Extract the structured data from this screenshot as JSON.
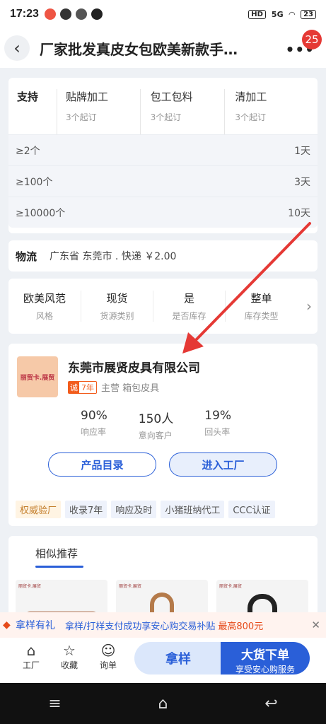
{
  "status_bar": {
    "time": "17:23",
    "signal": "5G",
    "battery": "23",
    "sim_label": "HD"
  },
  "header": {
    "title": "厂家批发真皮女包欧美新款手…",
    "badge_count": "25"
  },
  "support": {
    "label": "支持",
    "services": [
      {
        "name": "贴牌加工",
        "min": "3个起订"
      },
      {
        "name": "包工包料",
        "min": "3个起订"
      },
      {
        "name": "清加工",
        "min": "3个起订"
      }
    ],
    "tiers": [
      {
        "qty": "≥2个",
        "days": "1天"
      },
      {
        "qty": "≥100个",
        "days": "3天"
      },
      {
        "qty": "≥10000个",
        "days": "10天"
      }
    ]
  },
  "logistics": {
    "label": "物流",
    "value": "广东省 东莞市 . 快递 ￥2.00"
  },
  "attributes": [
    {
      "value": "欧美风范",
      "key": "风格"
    },
    {
      "value": "现货",
      "key": "货源类别"
    },
    {
      "value": "是",
      "key": "是否库存"
    },
    {
      "value": "整单",
      "key": "库存类型"
    }
  ],
  "company": {
    "logo_text": "丽贸卡.展贸",
    "name": "东莞市展贤皮具有限公司",
    "cert_a": "诚",
    "cert_b": "7年",
    "main_business": "主营 箱包皮具",
    "stats": [
      {
        "value": "90%",
        "key": "响应率"
      },
      {
        "value": "150人",
        "key": "意向客户"
      },
      {
        "value": "19%",
        "key": "回头率"
      }
    ],
    "catalog_button": "产品目录",
    "factory_button": "进入工厂",
    "tags": [
      "权威验厂",
      "收录7年",
      "响应及时",
      "小猪班纳代工",
      "CCC认证"
    ]
  },
  "similar": {
    "title": "相似推荐",
    "thumb_label": "丽贸卡.展贸"
  },
  "promo": {
    "title": "拿样有礼",
    "text": "拿样/打样支付成功享安心购交易补贴",
    "highlight": "最高800元"
  },
  "action_bar": {
    "factory": "工厂",
    "favorite": "收藏",
    "inquiry": "询单",
    "sample": "拿样",
    "bulk_main": "大货下单",
    "bulk_sub": "享受安心购服务"
  },
  "colors": {
    "accent": "#2a5fd8",
    "promo_red": "#e64a19",
    "annotation_arrow": "#e53935"
  }
}
